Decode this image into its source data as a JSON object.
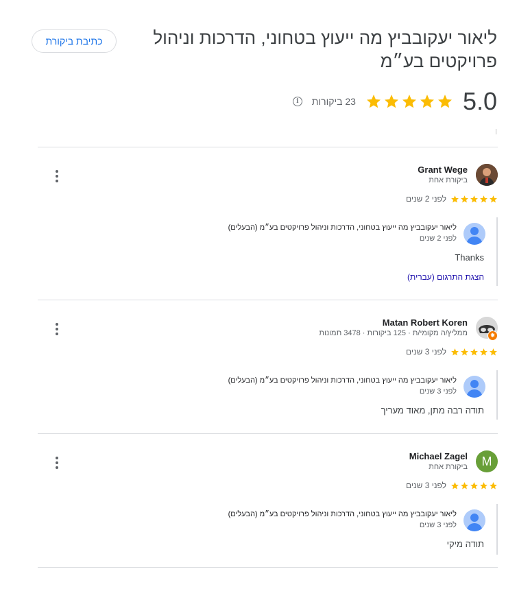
{
  "header": {
    "title": "ליאור יעקובביץ מה ייעוץ בטחוני, הדרכות וניהול פרויקטים בע״מ",
    "write_review_label": "כתיבת ביקורת",
    "rating": "5.0",
    "review_count": "23 ביקורות",
    "star_color": "#fbbc04"
  },
  "reviews": [
    {
      "name": "Grant Wege",
      "meta": "ביקורת אחת",
      "time": "לפני 2 שנים",
      "stars": 5,
      "avatar_icon": "profile-photo",
      "owner": {
        "name": "ליאור יעקובביץ מה ייעוץ בטחוני, הדרכות וניהול פרויקטים בע״מ (הבעלים)",
        "time": "לפני 2 שנים",
        "text": "Thanks",
        "translate": "הצגת התרגום (עברית)"
      }
    },
    {
      "name": "Matan Robert Koren",
      "meta": "ממליץ/ה מקומי/ת · 125 ביקורות · 3478 תמונות",
      "time": "לפני 3 שנים",
      "stars": 5,
      "avatar_icon": "local-guide-avatar",
      "owner": {
        "name": "ליאור יעקובביץ מה ייעוץ בטחוני, הדרכות וניהול פרויקטים בע״מ (הבעלים)",
        "time": "לפני 3 שנים",
        "text": "תודה רבה מתן, מאוד מעריך"
      }
    },
    {
      "name": "Michael Zagel",
      "meta": "ביקורת אחת",
      "time": "לפני 3 שנים",
      "stars": 5,
      "avatar_letter": "M",
      "avatar_color": "#689f38",
      "owner": {
        "name": "ליאור יעקובביץ מה ייעוץ בטחוני, הדרכות וניהול פרויקטים בע״מ (הבעלים)",
        "time": "לפני 3 שנים",
        "text": "תודה מיקי"
      }
    }
  ]
}
